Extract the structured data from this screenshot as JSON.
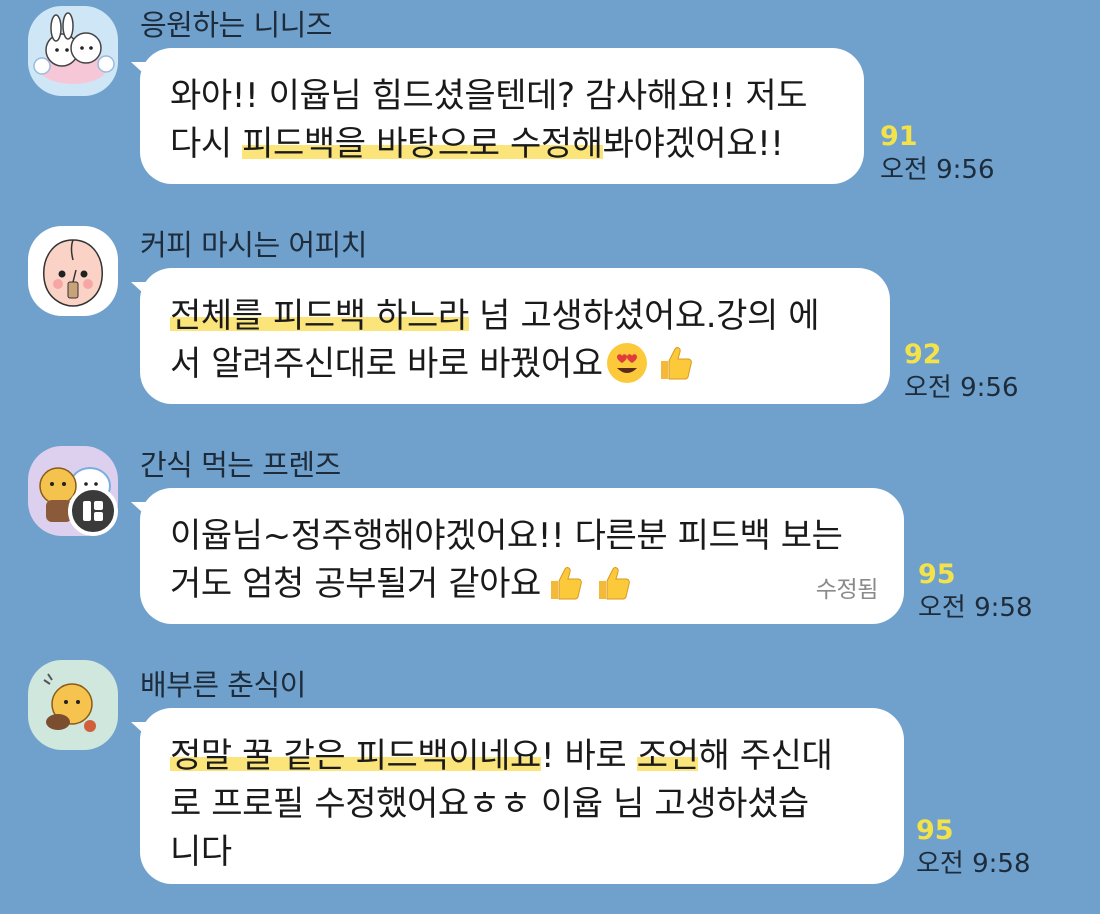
{
  "messages": [
    {
      "sender": "응원하는 니니즈",
      "avatar_icon": "ninize-character-avatar",
      "text_before": "와아!! 이윱님 힘드셨을텐데? 감사해요!! 저도",
      "text_line2_a": "다시 ",
      "text_line2_hl": "피드백을 바탕으로 수정해",
      "text_line2_b": "봐야겠어요!!",
      "read_count": "91",
      "time": "오전 9:56"
    },
    {
      "sender": "커피 마시는 어피치",
      "avatar_icon": "apeach-coffee-avatar",
      "text_line1_hl": "전체를 피드백 하느라",
      "text_line1_b": " 넘 고생하셨어요.강의 에",
      "text_line2": "서 알려주신대로 바로 바꿨어요",
      "emojis": [
        "heart-eyes-emoji",
        "thumbs-up-emoji"
      ],
      "read_count": "92",
      "time": "오전 9:56"
    },
    {
      "sender": "간식 먹는 프렌즈",
      "avatar_icon": "friends-snack-avatar",
      "text_line1": "이윱님~정주행해야겠어요!! 다른분 피드백 보는",
      "text_line2": "거도 엄청 공부될거 같아요",
      "emojis": [
        "thumbs-up-emoji",
        "thumbs-up-emoji"
      ],
      "edited_label": "수정됨",
      "read_count": "95",
      "time": "오전 9:58"
    },
    {
      "sender": "배부른 춘식이",
      "avatar_icon": "choonsik-full-avatar",
      "text_line1_hl": "정말 꿀 같은 피드백이네요",
      "text_line1_b": "! 바로 ",
      "text_line1_hl2": "조언",
      "text_line1_c": "해 주신대",
      "text_line2": "로 프로필 수정했어요ㅎㅎ 이윱 님 고생하셨습",
      "text_line3": "니다",
      "read_count": "95",
      "time": "오전 9:58"
    }
  ],
  "colors": {
    "background": "#6fa1cc",
    "bubble": "#ffffff",
    "highlight": "#fbe57a",
    "read_count": "#f3e24a"
  }
}
